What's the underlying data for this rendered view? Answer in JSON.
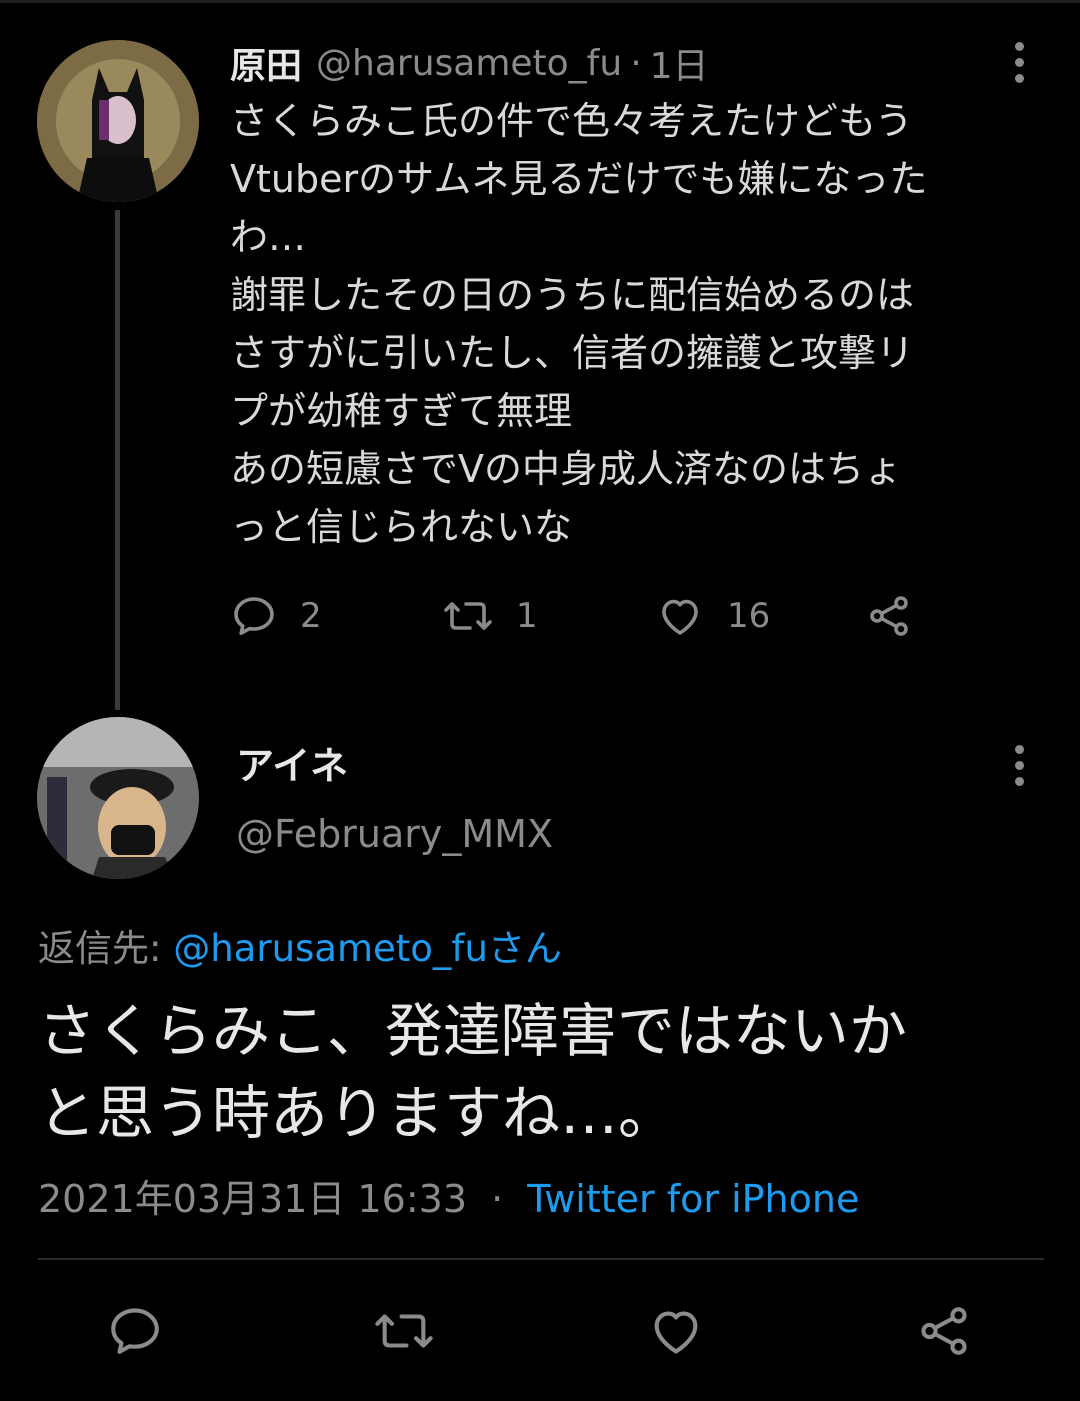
{
  "colors": {
    "background": "#000000",
    "text_primary": "#e7e7e7",
    "text_secondary": "#8b8b8b",
    "link": "#1d9bf0"
  },
  "parent_tweet": {
    "display_name": "原田",
    "handle": "@harusameto_fu",
    "separator": "·",
    "time_ago": "1日",
    "body": "さくらみこ氏の件で色々考えたけどもう\nVtuberのサムネ見るだけでも嫌になった\nわ…\n謝罪したその日のうちに配信始めるのは\nさすがに引いたし、信者の擁護と攻撃リ\nプが幼稚すぎて無理\nあの短慮さでVの中身成人済なのはちょ\nっと信じられないな",
    "replies": "2",
    "retweets": "1",
    "likes": "16",
    "icons": [
      "reply-icon",
      "retweet-icon",
      "like-icon",
      "share-icon",
      "more-icon"
    ]
  },
  "reply_tweet": {
    "display_name": "アイネ",
    "handle": "@February_MMX",
    "replying_to_label": "返信先:",
    "replying_to_mention": "@harusameto_fuさん",
    "body": "さくらみこ、発達障害ではないか\nと思う時ありますね…。",
    "timestamp": "2021年03月31日 16:33",
    "separator": "·",
    "source": "Twitter for iPhone"
  }
}
